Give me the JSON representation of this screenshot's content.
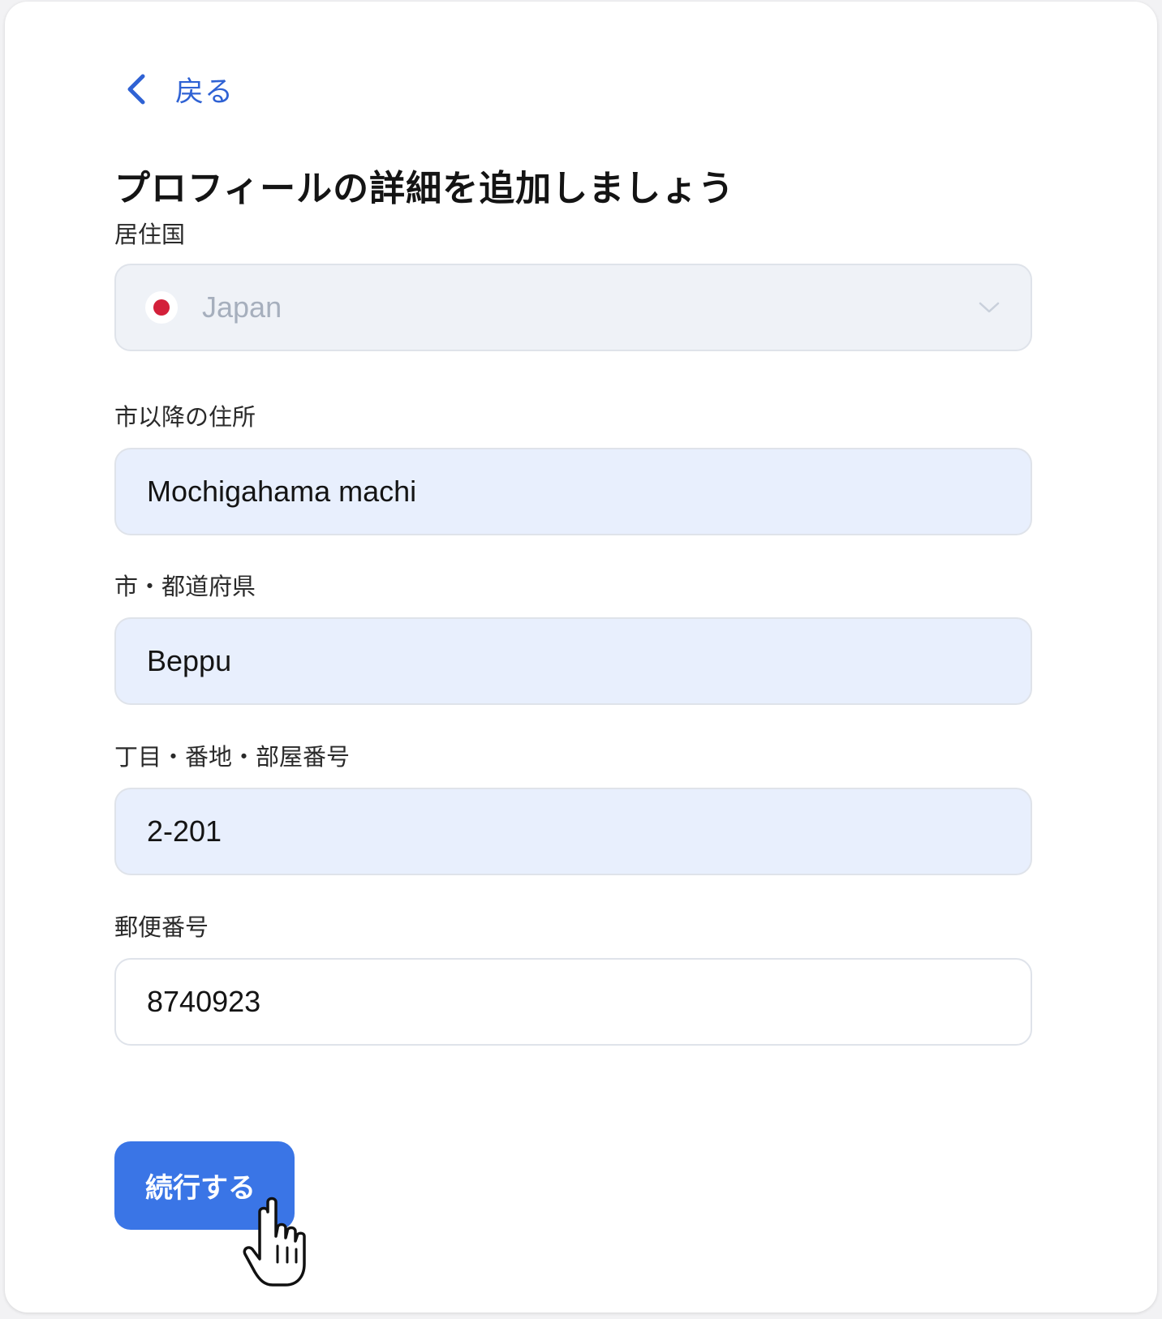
{
  "nav": {
    "back_label": "戻る"
  },
  "page_title": "プロフィールの詳細を追加しましょう",
  "fields": {
    "country": {
      "label": "居住国",
      "value": "Japan",
      "flag": "japan-flag"
    },
    "address_line": {
      "label": "市以降の住所",
      "value": "Mochigahama machi"
    },
    "city_prefecture": {
      "label": "市・都道府県",
      "value": "Beppu"
    },
    "block_room": {
      "label": "丁目・番地・部屋番号",
      "value": "2-201"
    },
    "postal_code": {
      "label": "郵便番号",
      "value": "8740923"
    }
  },
  "continue_button": {
    "label": "続行する"
  },
  "colors": {
    "accent": "#3a75e6",
    "link": "#2f62d4",
    "filled_field": "#e8effd",
    "disabled_field": "#eff2f7",
    "flag_red": "#d3203a"
  },
  "icons": [
    "chevron-left-icon",
    "chevron-down-icon",
    "hand-pointer-icon"
  ]
}
